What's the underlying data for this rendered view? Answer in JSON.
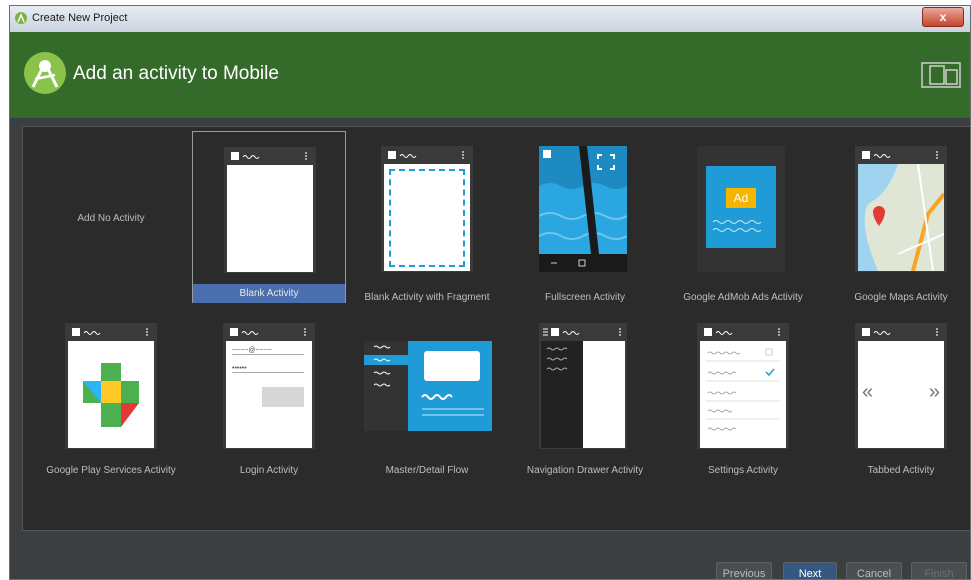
{
  "window": {
    "title": "Create New Project",
    "close_label": "x"
  },
  "header": {
    "title": "Add an activity to Mobile"
  },
  "activities": [
    {
      "label": "Add No Activity"
    },
    {
      "label": "Blank Activity"
    },
    {
      "label": "Blank Activity with Fragment"
    },
    {
      "label": "Fullscreen Activity"
    },
    {
      "label": "Google AdMob Ads Activity",
      "badge": "Ad"
    },
    {
      "label": "Google Maps Activity"
    },
    {
      "label": "Google Play Services Activity"
    },
    {
      "label": "Login Activity",
      "email_placeholder": "~~~~@~~~~",
      "password_mask": "••••••"
    },
    {
      "label": "Master/Detail Flow"
    },
    {
      "label": "Navigation Drawer Activity"
    },
    {
      "label": "Settings Activity"
    },
    {
      "label": "Tabbed Activity",
      "left_arrow": "«",
      "right_arrow": "»"
    }
  ],
  "buttons": {
    "previous": "Previous",
    "next": "Next",
    "cancel": "Cancel",
    "finish": "Finish"
  },
  "colors": {
    "header": "#346b2b",
    "selected": "#4b6eaf",
    "accent_blue": "#1f9bd6"
  }
}
